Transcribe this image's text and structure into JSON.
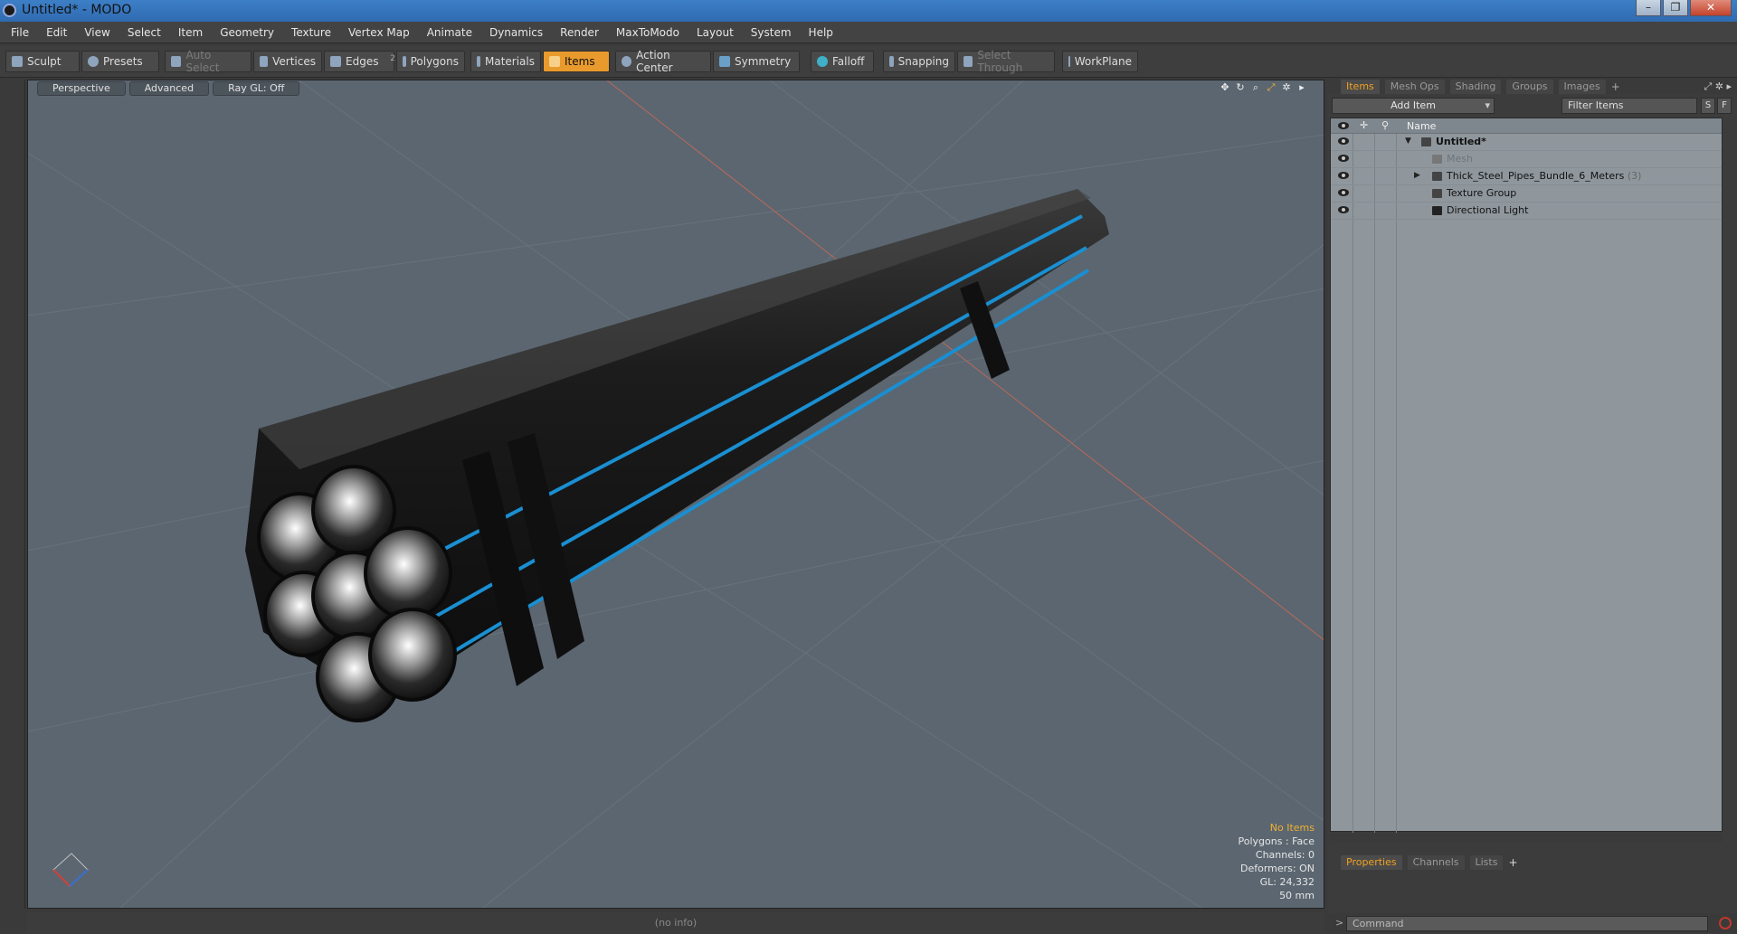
{
  "window": {
    "title": "Untitled* - MODO"
  },
  "menu": [
    "File",
    "Edit",
    "View",
    "Select",
    "Item",
    "Geometry",
    "Texture",
    "Vertex Map",
    "Animate",
    "Dynamics",
    "Render",
    "MaxToModo",
    "Layout",
    "System",
    "Help"
  ],
  "toolbar": {
    "sculpt": "Sculpt",
    "presets": "Presets",
    "auto_select": "Auto Select",
    "vertices": "Vertices",
    "edges": "Edges",
    "edges_count": "2",
    "polygons": "Polygons",
    "materials": "Materials",
    "items": "Items",
    "action_center": "Action Center",
    "symmetry": "Symmetry",
    "falloff": "Falloff",
    "snapping": "Snapping",
    "select_through": "Select Through",
    "workplane": "WorkPlane"
  },
  "viewport": {
    "tabs": [
      "Perspective",
      "Advanced",
      "Ray GL: Off"
    ],
    "info": {
      "status": "No Items",
      "polygons": "Polygons : Face",
      "channels": "Channels: 0",
      "deformers": "Deformers: ON",
      "gl": "GL: 24,332",
      "scale": "50 mm"
    },
    "colors": {
      "background": "#5b6670",
      "stripe": "#1a8fd1"
    }
  },
  "statusbar": {
    "text": "(no info)"
  },
  "panel": {
    "tabs": [
      "Items",
      "Mesh Ops",
      "Shading",
      "Groups",
      "Images"
    ],
    "add_item": "Add Item",
    "filter_placeholder": "Filter Items",
    "s_btn": "S",
    "f_btn": "F",
    "column_name": "Name",
    "tree": [
      {
        "label": "Untitled*",
        "style": "bold"
      },
      {
        "label": "Mesh",
        "style": "dim"
      },
      {
        "label": "Thick_Steel_Pipes_Bundle_6_Meters",
        "count": "(3)"
      },
      {
        "label": "Texture Group"
      },
      {
        "label": "Directional Light"
      }
    ],
    "bottom_tabs": [
      "Properties",
      "Channels",
      "Lists"
    ],
    "command_placeholder": "Command"
  }
}
